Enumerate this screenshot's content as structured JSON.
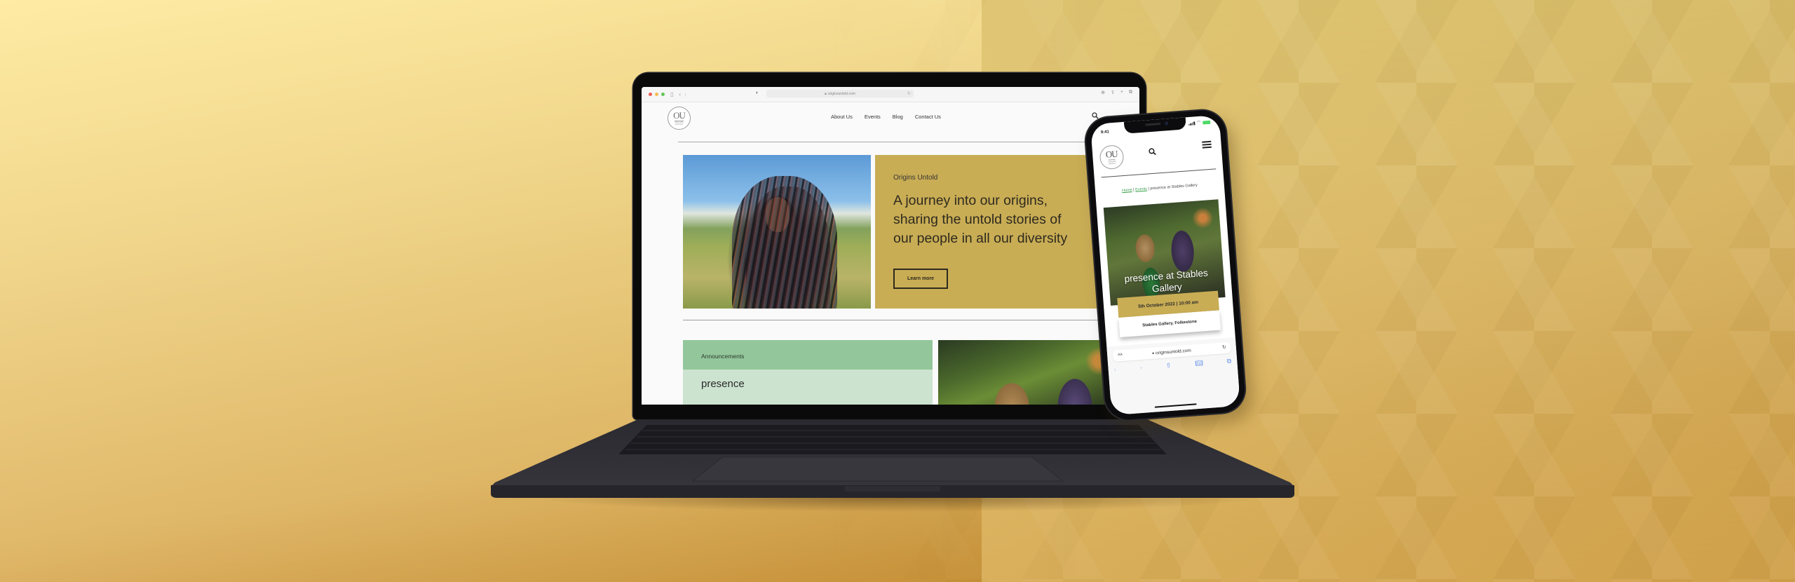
{
  "laptop": {
    "browser": {
      "url": "originsuntold.com",
      "lock_icon": "lock-icon",
      "icons": [
        "sidebar-icon",
        "back-icon",
        "forward-icon",
        "privacy-shield-icon",
        "reload-icon",
        "download-icon",
        "share-icon",
        "new-tab-icon",
        "tabs-icon"
      ]
    },
    "site": {
      "logo": {
        "mark": "OU",
        "subtitle_line1": "ORIGINS",
        "subtitle_line2": "UNTOLD"
      },
      "nav": [
        {
          "label": "About Us"
        },
        {
          "label": "Events"
        },
        {
          "label": "Blog"
        },
        {
          "label": "Contact Us"
        }
      ],
      "search_icon": "search-icon",
      "hero": {
        "kicker": "Origins Untold",
        "title": "A journey into our origins, sharing the untold stories of our people in all our diversity",
        "button_label": "Learn more",
        "card_color": "#c9ad55"
      },
      "announcement": {
        "header": "Announcements",
        "title": "presence",
        "header_color": "#93c69b",
        "body_color": "#cce3cf"
      }
    }
  },
  "phone": {
    "status": {
      "time": "9:41"
    },
    "site": {
      "logo": {
        "mark": "OU",
        "subtitle_line1": "ORIGINS",
        "subtitle_line2": "UNTOLD"
      },
      "breadcrumb": {
        "home": "Home",
        "separator": " | ",
        "events": "Events",
        "current": "presence at Stables Gallery"
      },
      "event": {
        "title": "presence at Stables Gallery",
        "date": "5th October 2022 | 10:00 am",
        "venue": "Stables Gallery, Folkestone"
      }
    },
    "browser": {
      "text_size_label": "AA",
      "url": "originsuntold.com"
    }
  },
  "theme": {
    "accent_gold": "#c9ad55",
    "link_green": "#3aa04a"
  }
}
